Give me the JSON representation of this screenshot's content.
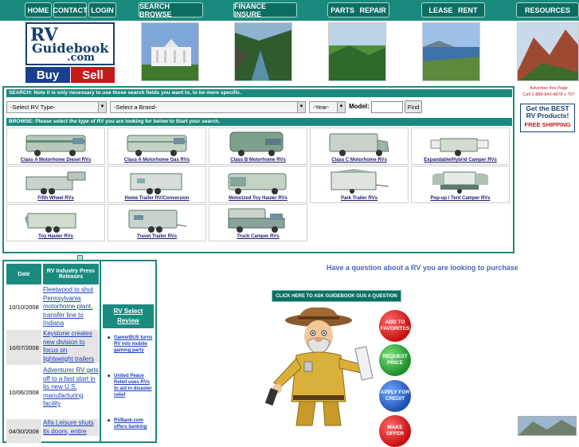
{
  "nav": [
    {
      "label": "HOME"
    },
    {
      "label": "CONTACT"
    },
    {
      "label": "LOGIN"
    },
    {
      "label": "SEARCH BROWSE"
    },
    {
      "label": "FINANCE INSURE"
    },
    {
      "label": "PARTS REPAIR"
    },
    {
      "label": "LEASE RENT"
    },
    {
      "label": "RESOURCES"
    }
  ],
  "logo": {
    "rv": "RV",
    "guidebook": "Guidebook",
    "com": ".com",
    "buy": "Buy",
    "sell": "Sell"
  },
  "search": {
    "header": "SEARCH: Note it is only necessary to use those search fields you want to, to be more specific.",
    "rv_type": "-Select RV Type-",
    "brand": "-Select a Brand-",
    "year": "-Year-",
    "model_label": "Model:",
    "model_value": "",
    "find_label": "Find"
  },
  "browse": {
    "header": "BROWSE: Please select the type of RV you are looking for below to Start your search.",
    "types": [
      {
        "label": "Class A Motorhome Diesel RVs",
        "icon": "class-a-diesel-icon"
      },
      {
        "label": "Class A Motorhome Gas RVs",
        "icon": "class-a-gas-icon"
      },
      {
        "label": "Class B Motorhome RVs",
        "icon": "class-b-icon"
      },
      {
        "label": "Class C Motorhome RVs",
        "icon": "class-c-icon"
      },
      {
        "label": "Expandable/Hybrid Camper RVs",
        "icon": "hybrid-camper-icon"
      },
      {
        "label": "Fifth Wheel RVs",
        "icon": "fifth-wheel-icon"
      },
      {
        "label": "Home Trailer RV/Conversion",
        "icon": "home-trailer-icon"
      },
      {
        "label": "Motorized Toy Hauler RVs",
        "icon": "toy-hauler-motorized-icon"
      },
      {
        "label": "Park Trailer RVs",
        "icon": "park-trailer-icon"
      },
      {
        "label": "Pop-up / Tent Camper RVs",
        "icon": "popup-camper-icon"
      },
      {
        "label": "Toy Hauler RVs",
        "icon": "toy-hauler-icon"
      },
      {
        "label": "Travel Trailer RVs",
        "icon": "travel-trailer-icon"
      },
      {
        "label": "Truck Camper RVs",
        "icon": "truck-camper-icon"
      }
    ]
  },
  "news": {
    "date_header": "Date",
    "title_header": "RV Industry Press Releases",
    "items": [
      {
        "date": "10/10/2008",
        "title": "Fleetwood to shut Pennsylvania motorhome plant, transfer line to Indiana"
      },
      {
        "date": "10/07/2008",
        "title": "Keystone creates new division to focus on lightweight trailers"
      },
      {
        "date": "10/06/2008",
        "title": "Adventurer RV gets off to a fast start in its new U.S. manufacturing facility"
      },
      {
        "date": "04/30/2008",
        "title": "Alfa Leisure shuts its doors, entire"
      }
    ]
  },
  "review": {
    "title": "RV Select Review",
    "items": [
      {
        "text": "GamerBUS turns RV into mobile gaming party"
      },
      {
        "text": "United Peace Relief uses RVs to aid in disaster relief"
      },
      {
        "text": "RVBank.com offers banking"
      }
    ]
  },
  "question_banner": "Have a question about a RV you are looking to purchase. A",
  "ask_button": "CLICK HERE TO ASK GUIDEBOOK GUS A QUESTION",
  "actions": [
    {
      "label": "ADD TO FAVORITES"
    },
    {
      "label": "REQUEST PRICE"
    },
    {
      "label": "APPLY FOR CREDIT"
    },
    {
      "label": "MAKE OFFER"
    }
  ],
  "ad": {
    "advertise": "Advertise this Page",
    "phone": "Call 1-888-843-4878 x 707",
    "best_line1": "Get the BEST",
    "best_line2": "RV Products!",
    "free_shipping": "FREE SHIPPING"
  },
  "colors": {
    "teal": "#1b8a7e",
    "dark_teal": "#0c6e63",
    "navy": "#16406e",
    "red": "#c61a1a",
    "link": "#1a3fbf"
  }
}
